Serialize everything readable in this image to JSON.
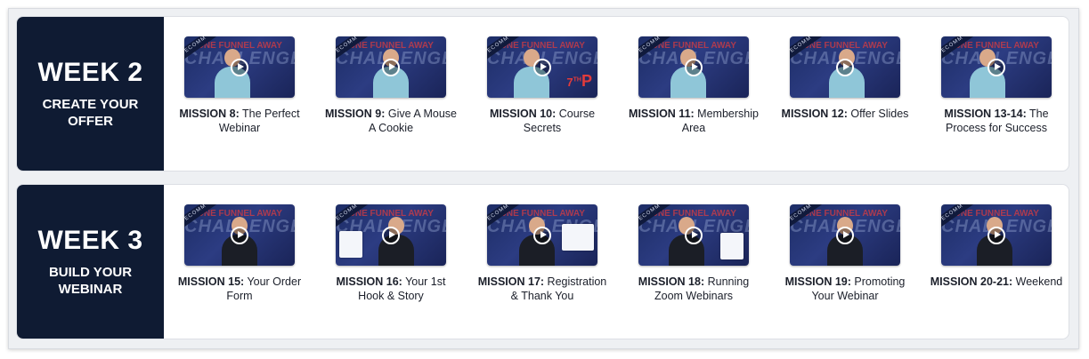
{
  "weeks": [
    {
      "title": "WEEK 2",
      "subtitle": "CREATE YOUR OFFER",
      "missions": [
        {
          "label": "MISSION 8:",
          "name": "The Perfect Webinar"
        },
        {
          "label": "MISSION 9:",
          "name": "Give A Mouse A Cookie"
        },
        {
          "label": "MISSION 10:",
          "name": "Course Secrets"
        },
        {
          "label": "MISSION 11:",
          "name": "Membership Area"
        },
        {
          "label": "MISSION 12:",
          "name": "Offer Slides"
        },
        {
          "label": "MISSION 13-14:",
          "name": "The Process for Success"
        }
      ]
    },
    {
      "title": "WEEK 3",
      "subtitle": "BUILD YOUR WEBINAR",
      "missions": [
        {
          "label": "MISSION 15:",
          "name": "Your Order Form"
        },
        {
          "label": "MISSION 16:",
          "name": "Your 1st Hook & Story"
        },
        {
          "label": "MISSION 17:",
          "name": "Registration & Thank You"
        },
        {
          "label": "MISSION 18:",
          "name": "Running Zoom Webinars"
        },
        {
          "label": "MISSION 19:",
          "name": "Promoting Your Webinar"
        },
        {
          "label": "MISSION 20-21:",
          "name": "Weekend"
        }
      ]
    }
  ],
  "thumbnail": {
    "ribbon_text": "ECOMM",
    "brand_top": "ONE FUNNEL AWAY",
    "brand_main": "CHALLENGE",
    "badge_7th": "7THP"
  },
  "colors": {
    "week_panel": "#0f1b33",
    "thumb_bg": "#23326f",
    "accent_red": "#e23b3b"
  },
  "icons": {
    "play": "play-circle-icon"
  }
}
